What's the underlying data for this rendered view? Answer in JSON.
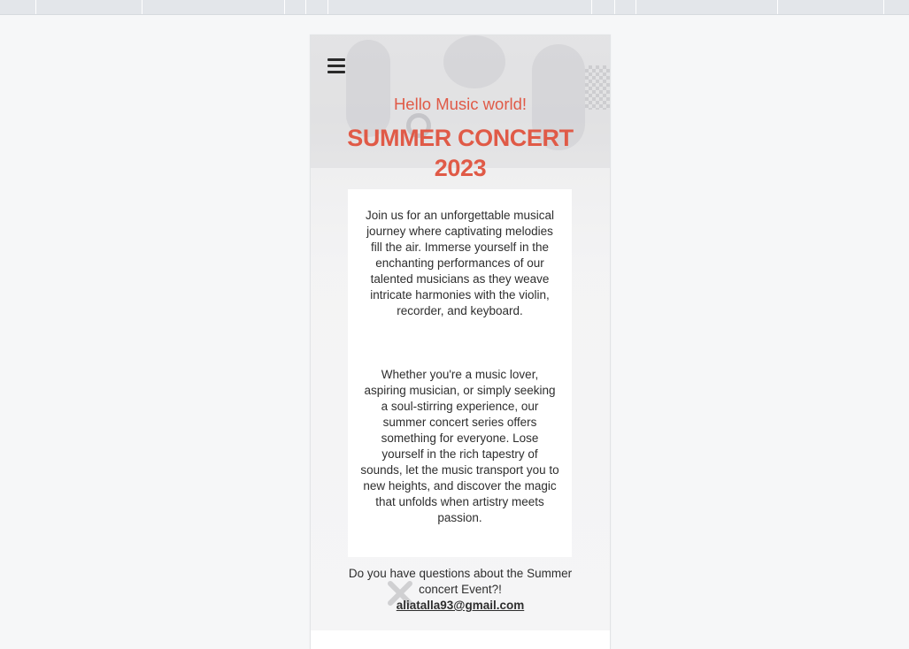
{
  "page": {
    "greeting": "Hello Music world!",
    "title": "SUMMER CONCERT 2023",
    "paragraph_1": "Join us for an unforgettable musical journey where captivating melodies fill the air. Immerse yourself in the enchanting performances of our talented musicians as they weave intricate harmonies with the violin, recorder, and keyboard.",
    "paragraph_2": "Whether you're a music lover, aspiring musician, or simply seeking a soul-stirring experience, our summer concert series offers something for everyone. Lose yourself in the rich tapestry of sounds, let the music transport you to new heights, and discover the magic that unfolds when artistry meets passion.",
    "question": "Do you have questions about the Summer concert Event?!",
    "email": "aliatalla93@gmail.com"
  },
  "icons": {
    "menu": "hamburger-menu-icon"
  },
  "colors": {
    "accent": "#e05a47",
    "text": "#2e2e2e",
    "page_background": "#f6f7f8"
  }
}
